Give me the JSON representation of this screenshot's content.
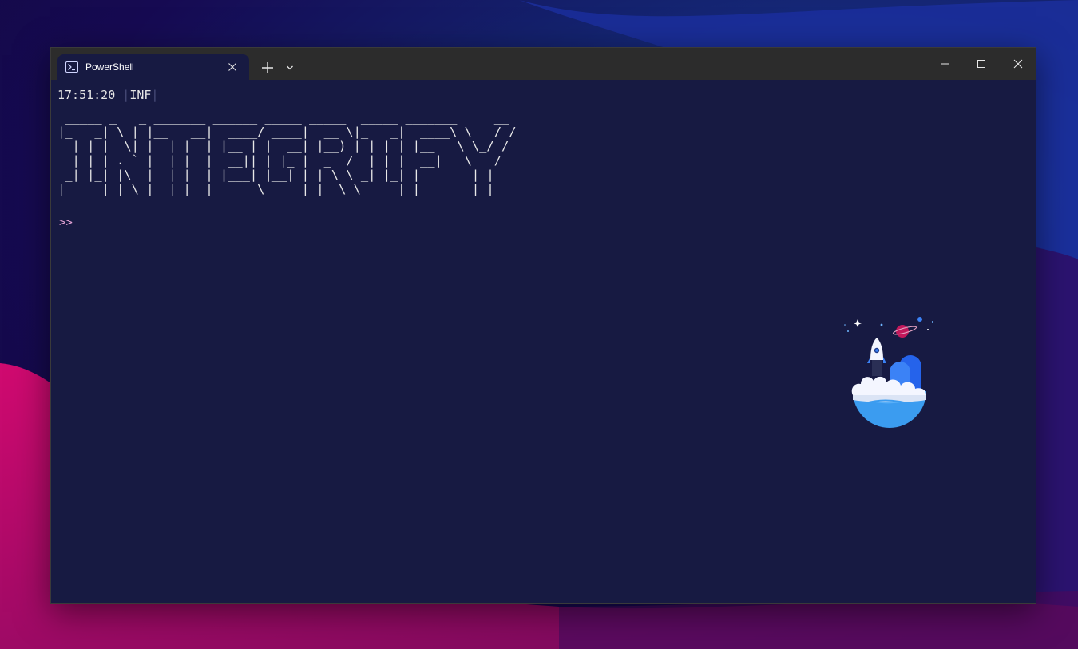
{
  "window": {
    "tab_title": "PowerShell",
    "tab_icon": "powershell-icon",
    "close_tab_glyph": "✕",
    "new_tab_glyph": "+",
    "dropdown_icon": "chevron-down-icon",
    "caption_buttons": [
      "minimize-icon",
      "maximize-icon",
      "close-icon"
    ]
  },
  "terminal": {
    "timestamp": "17:51:20",
    "separator": "|",
    "level": "INF",
    "ascii_art": " _____ _   _ _______ ______ _____ _____  _____ _______     __\n|_   _| \\ | |__   __|  ____/ ____|  __ \\|_   _|  ____\\ \\   / /\n  | | |  \\| |  | |  | |__ | |  __| |__) | | | | |__   \\ \\_/ /\n  | | | . ` |  | |  |  __|| | |_ |  _  /  | | |  __|   \\   /\n _| |_| |\\  |  | |  | |___| |__| | | \\ \\ _| |_| |       | |\n|_____|_| \\_|  |_|  |______\\_____|_|  \\_\\_____|_|       |_|",
    "prompt": ">>"
  },
  "colors": {
    "terminal_bg": "#171a42",
    "titlebar_bg": "#2c2c2c",
    "prompt": "#e8a6d8",
    "text": "#e6e6e6"
  },
  "illustration": "rocket-launch-illustration"
}
